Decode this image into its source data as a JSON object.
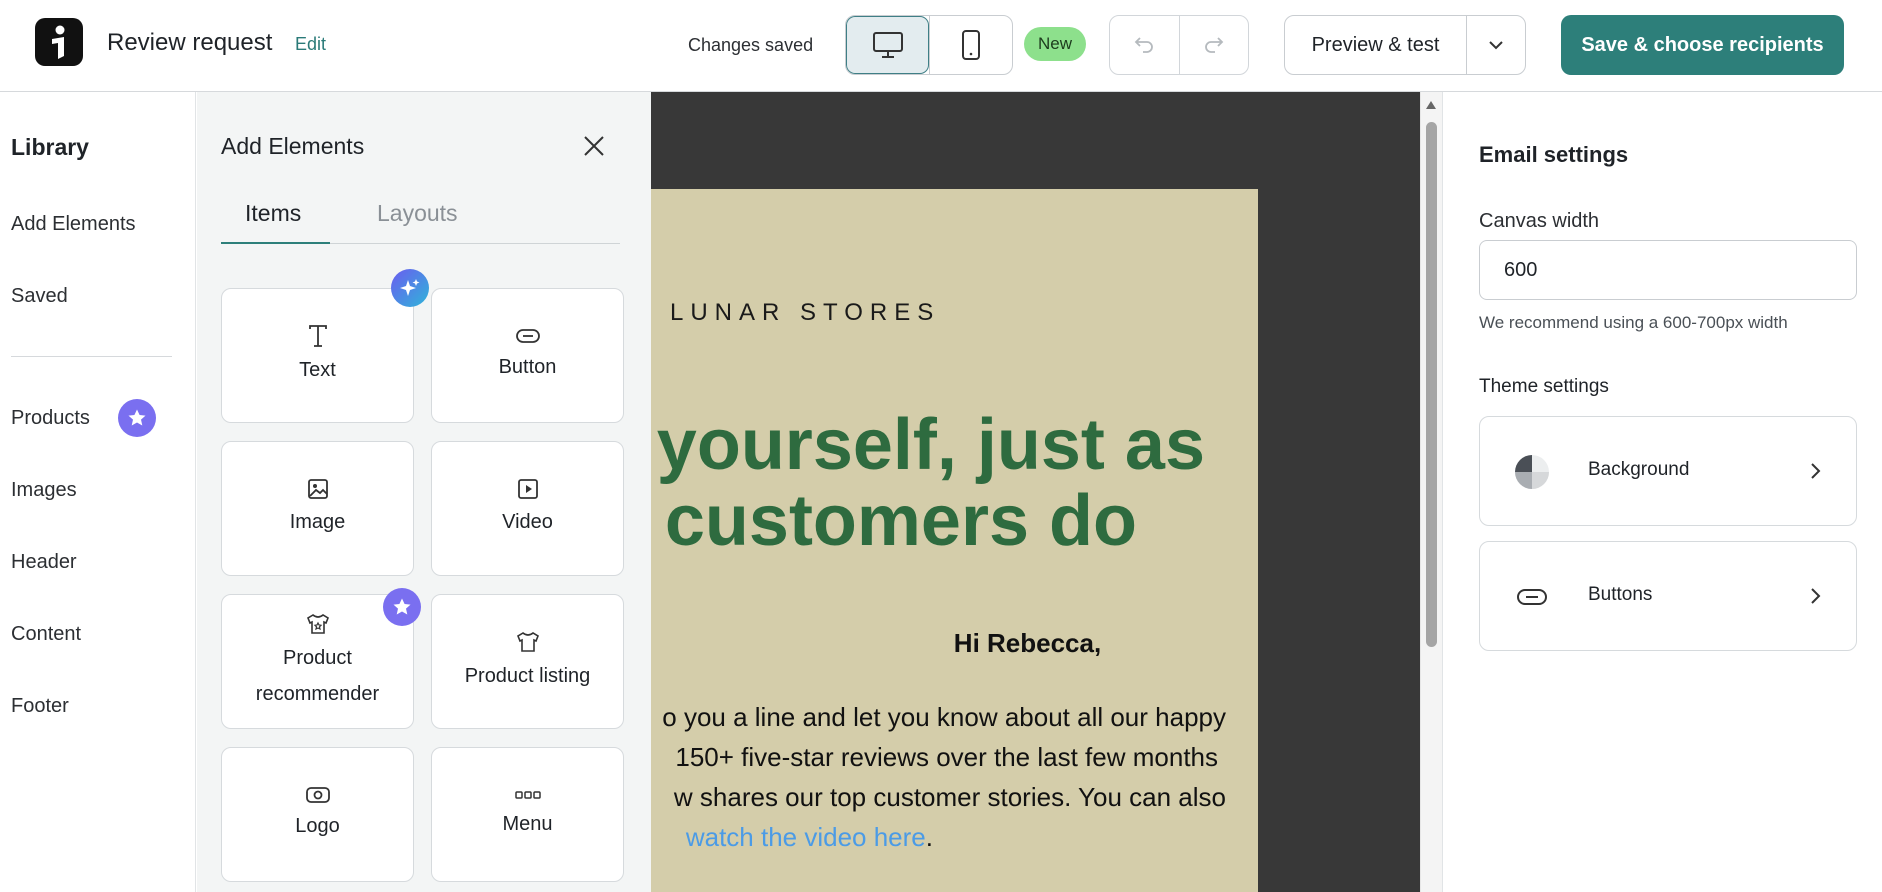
{
  "header": {
    "title": "Review request",
    "edit_label": "Edit",
    "status": "Changes saved",
    "new_badge": "New",
    "preview_label": "Preview & test",
    "save_label": "Save & choose recipients"
  },
  "library": {
    "title": "Library",
    "items": [
      "Add Elements",
      "Saved",
      "Products",
      "Images",
      "Header",
      "Content",
      "Footer"
    ]
  },
  "add_panel": {
    "title": "Add Elements",
    "tabs": [
      "Items",
      "Layouts"
    ],
    "active_tab": "Items",
    "tiles": [
      {
        "label": "Text",
        "icon": "text-icon",
        "badge": "ai-sparkle"
      },
      {
        "label": "Button",
        "icon": "button-icon"
      },
      {
        "label": "Image",
        "icon": "image-icon"
      },
      {
        "label": "Video",
        "icon": "video-icon"
      },
      {
        "label": "Product recommender",
        "icon": "product-recommender-icon",
        "badge": "star"
      },
      {
        "label": "Product listing",
        "icon": "product-listing-icon"
      },
      {
        "label": "Logo",
        "icon": "logo-icon"
      },
      {
        "label": "Menu",
        "icon": "menu-icon"
      }
    ]
  },
  "email": {
    "brand": "LUNAR STORES",
    "headline_line1": "yourself, just as",
    "headline_line2": "customers do",
    "greeting": "Hi Rebecca,",
    "body_line1": "o you a line and let you know about all our happy",
    "body_line2": "150+ five-star reviews over the last few months",
    "body_line3": "w shares our top customer stories. You can also",
    "body_link": "watch the video here",
    "body_after_link": "."
  },
  "settings": {
    "title": "Email settings",
    "canvas_width_label": "Canvas width",
    "canvas_width_value": "600",
    "canvas_width_hint": "We recommend using a 600-700px width",
    "theme_label": "Theme settings",
    "cards": [
      {
        "label": "Background",
        "icon": "background-icon"
      },
      {
        "label": "Buttons",
        "icon": "buttons-icon"
      }
    ]
  },
  "colors": {
    "accent": "#2d7f7a",
    "new_badge": "#8de08c",
    "star_badge": "#7a6ff0",
    "headline": "#2e6b3f",
    "email_bg": "#d4cdaa",
    "canvas_bg": "#383838",
    "link": "#4b9be6"
  }
}
